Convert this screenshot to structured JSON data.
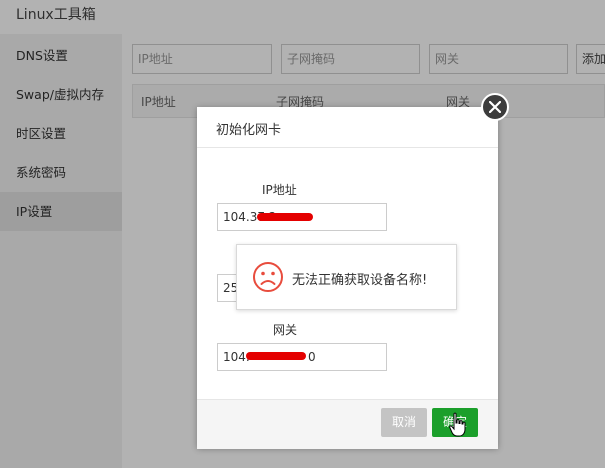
{
  "app": {
    "title": "Linux工具箱"
  },
  "sidebar": {
    "items": [
      {
        "label": "DNS设置"
      },
      {
        "label": "Swap/虚拟内存"
      },
      {
        "label": "时区设置"
      },
      {
        "label": "系统密码"
      },
      {
        "label": "IP设置"
      }
    ],
    "active_index": 4
  },
  "main": {
    "inputs": {
      "ip_placeholder": "IP地址",
      "mask_placeholder": "子网掩码",
      "gateway_placeholder": "网关"
    },
    "add_button": "添加",
    "table": {
      "headers": [
        "IP地址",
        "子网掩码",
        "网关"
      ]
    }
  },
  "dialog": {
    "title": "初始化网卡",
    "fields": {
      "ip_label": "IP地址",
      "ip_value": "104.37.2",
      "mask_value": "25",
      "gateway_label": "网关",
      "gateway_value": "104.",
      "gateway_value_tail": "0"
    },
    "cancel_label": "取消",
    "confirm_label": "确定"
  },
  "toast": {
    "message": "无法正确获取设备名称!",
    "icon": "sad-face-icon"
  },
  "colors": {
    "confirm": "#1b9f2b",
    "cancel": "#c4c4c4",
    "error_icon": "#e84c3d",
    "redaction": "#e40000"
  }
}
